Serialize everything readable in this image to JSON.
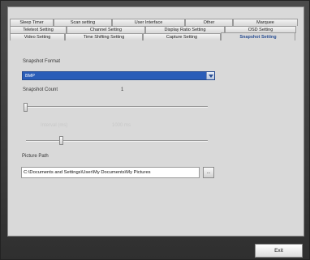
{
  "tabs": {
    "row1": [
      "Sleep Timer",
      "Scan setting",
      "User Interface",
      "Other",
      "Marquee"
    ],
    "row2": [
      "Teletext Setting",
      "Channel Setting",
      "Display Ratio Setting",
      "OSD Setting"
    ],
    "row3": [
      "Video Setting",
      "Time Shifting Setting",
      "Capture Setting",
      "Snapshot Setting"
    ],
    "active": "Snapshot Setting"
  },
  "snapshot": {
    "format_label": "Snapshot Format",
    "format_value": "BMP",
    "count_label": "Snapshot Count",
    "count_value": "1",
    "count_slider_level": 0,
    "interval_label_left": "Interval (ms)",
    "interval_label_right": "1000 ms",
    "interval_slider_level": 0.2,
    "path_label": "Picture Path",
    "path_value": "C:\\Documents and Settings\\User\\My Documents\\My Pictures",
    "browse_label": "..."
  },
  "footer": {
    "exit_label": "Exit"
  },
  "icons": {
    "dropdown": "chevron-down-icon"
  }
}
